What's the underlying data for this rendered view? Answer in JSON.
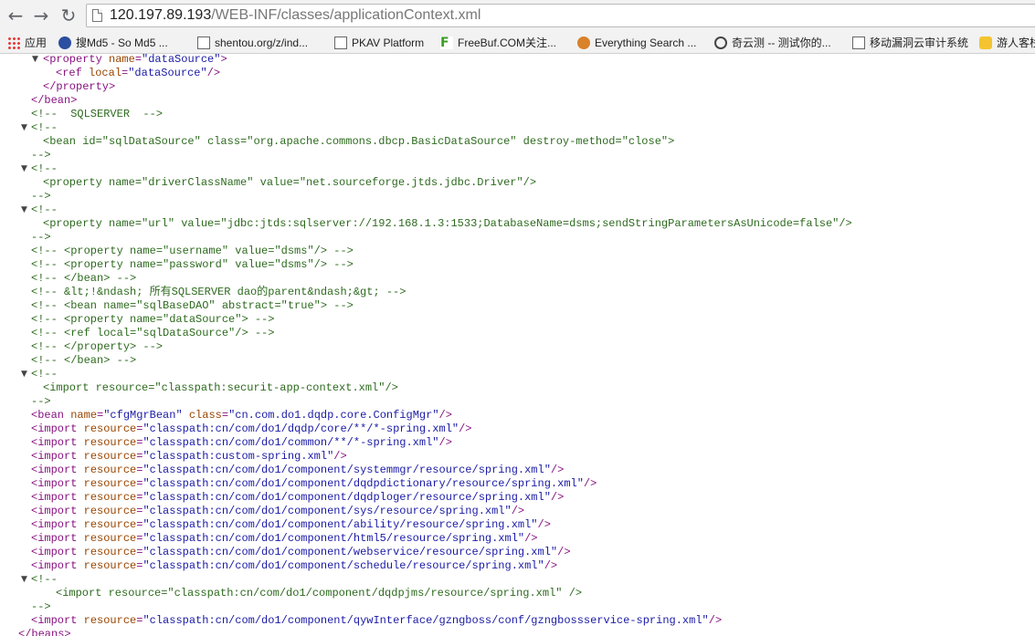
{
  "browser": {
    "url_host": "120.197.89.193",
    "url_path": "/WEB-INF/classes/applicationContext.xml",
    "nav": {
      "back_icon": "←",
      "forward_icon": "→",
      "reload_icon": "↻"
    }
  },
  "bookmarks": [
    {
      "label": "应用",
      "icon": "apps-icon"
    },
    {
      "label": "搜Md5 - So Md5 ...",
      "icon": "so-icon"
    },
    {
      "label": "shentou.org/z/ind...",
      "icon": "page-icon"
    },
    {
      "label": "PKAV Platform",
      "icon": "page-icon"
    },
    {
      "label": "FreeBuf.COM关注...",
      "icon": "freebuf-icon"
    },
    {
      "label": "Everything Search ...",
      "icon": "search-icon"
    },
    {
      "label": "奇云测 -- 测试你的...",
      "icon": "clock-icon"
    },
    {
      "label": "移动漏洞云审计系统",
      "icon": "page-icon"
    },
    {
      "label": "游人客栈",
      "icon": "star-icon"
    }
  ],
  "xml": {
    "twisty_open": "▼",
    "lines": [
      {
        "kind": "tag",
        "text": "<property name=\"dataSource\">"
      },
      {
        "kind": "tag",
        "text": "<ref local=\"dataSource\"/>"
      },
      {
        "kind": "tag",
        "text": "</property>"
      },
      {
        "kind": "tag",
        "text": "</bean>"
      },
      {
        "kind": "comment",
        "text": "<!--  SQLSERVER  -->"
      },
      {
        "kind": "comment",
        "text": "<!--"
      },
      {
        "kind": "comment",
        "text": "<bean id=\"sqlDataSource\" class=\"org.apache.commons.dbcp.BasicDataSource\" destroy-method=\"close\">"
      },
      {
        "kind": "comment",
        "text": "-->"
      },
      {
        "kind": "comment",
        "text": "<!--"
      },
      {
        "kind": "comment",
        "text": "<property name=\"driverClassName\" value=\"net.sourceforge.jtds.jdbc.Driver\"/>"
      },
      {
        "kind": "comment",
        "text": "-->"
      },
      {
        "kind": "comment",
        "text": "<!--"
      },
      {
        "kind": "comment",
        "text": "<property name=\"url\" value=\"jdbc:jtds:sqlserver://192.168.1.3:1533;DatabaseName=dsms;sendStringParametersAsUnicode=false\"/>"
      },
      {
        "kind": "comment",
        "text": "-->"
      },
      {
        "kind": "comment",
        "text": "<!-- <property name=\"username\" value=\"dsms\"/> -->"
      },
      {
        "kind": "comment",
        "text": "<!-- <property name=\"password\" value=\"dsms\"/> -->"
      },
      {
        "kind": "comment",
        "text": "<!-- </bean> -->"
      },
      {
        "kind": "comment",
        "text": "<!-- &lt;!&ndash; 所有SQLSERVER dao的parent&ndash;&gt; -->"
      },
      {
        "kind": "comment",
        "text": "<!-- <bean name=\"sqlBaseDAO\" abstract=\"true\"> -->"
      },
      {
        "kind": "comment",
        "text": "<!-- <property name=\"dataSource\"> -->"
      },
      {
        "kind": "comment",
        "text": "<!-- <ref local=\"sqlDataSource\"/> -->"
      },
      {
        "kind": "comment",
        "text": "<!-- </property> -->"
      },
      {
        "kind": "comment",
        "text": "<!-- </bean> -->"
      },
      {
        "kind": "comment",
        "text": "<!--"
      },
      {
        "kind": "comment",
        "text": "<import resource=\"classpath:securit-app-context.xml\"/>"
      },
      {
        "kind": "comment",
        "text": "-->"
      },
      {
        "kind": "tag",
        "text": "<bean name=\"cfgMgrBean\" class=\"cn.com.do1.dqdp.core.ConfigMgr\"/>"
      },
      {
        "kind": "tag",
        "text": "<import resource=\"classpath:cn/com/do1/dqdp/core/**/*-spring.xml\"/>"
      },
      {
        "kind": "tag",
        "text": "<import resource=\"classpath:cn/com/do1/common/**/*-spring.xml\"/>"
      },
      {
        "kind": "tag",
        "text": "<import resource=\"classpath:custom-spring.xml\"/>"
      },
      {
        "kind": "tag",
        "text": "<import resource=\"classpath:cn/com/do1/component/systemmgr/resource/spring.xml\"/>"
      },
      {
        "kind": "tag",
        "text": "<import resource=\"classpath:cn/com/do1/component/dqdpdictionary/resource/spring.xml\"/>"
      },
      {
        "kind": "tag",
        "text": "<import resource=\"classpath:cn/com/do1/component/dqdploger/resource/spring.xml\"/>"
      },
      {
        "kind": "tag",
        "text": "<import resource=\"classpath:cn/com/do1/component/sys/resource/spring.xml\"/>"
      },
      {
        "kind": "tag",
        "text": "<import resource=\"classpath:cn/com/do1/component/ability/resource/spring.xml\"/>"
      },
      {
        "kind": "tag",
        "text": "<import resource=\"classpath:cn/com/do1/component/html5/resource/spring.xml\"/>"
      },
      {
        "kind": "tag",
        "text": "<import resource=\"classpath:cn/com/do1/component/webservice/resource/spring.xml\"/>"
      },
      {
        "kind": "tag",
        "text": "<import resource=\"classpath:cn/com/do1/component/schedule/resource/spring.xml\"/>"
      },
      {
        "kind": "comment",
        "text": "<!--"
      },
      {
        "kind": "comment",
        "text": "<import resource=\"classpath:cn/com/do1/component/dqdpjms/resource/spring.xml\" />"
      },
      {
        "kind": "comment",
        "text": "-->"
      },
      {
        "kind": "tag",
        "text": "<import resource=\"classpath:cn/com/do1/component/qywInterface/gzngboss/conf/gzngbossservice-spring.xml\"/>"
      },
      {
        "kind": "tag",
        "text": "</beans>"
      }
    ]
  }
}
